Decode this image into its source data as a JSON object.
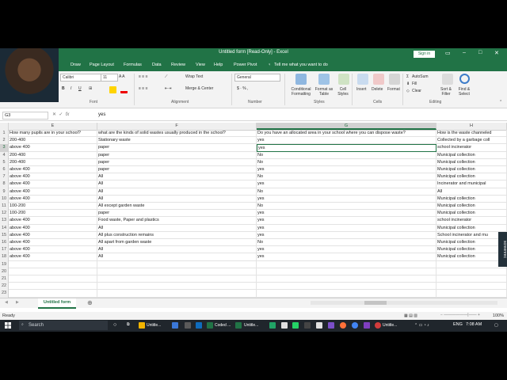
{
  "window": {
    "title": "Untitled form  [Read-Only]  -  Excel",
    "signin": "Sign in"
  },
  "tabs": [
    "et",
    "Draw",
    "Page Layout",
    "Formulas",
    "Data",
    "Review",
    "View",
    "Help",
    "Power Pivot",
    "Tell me what you want to do"
  ],
  "ribbon": {
    "font_name": "Calibri",
    "font_size": "11",
    "wrap_text": "Wrap Text",
    "merge_center": "Merge & Center",
    "number_format": "General",
    "number_symbols": "$ · % ,",
    "conditional_formatting": "Conditional Formatting",
    "format_as_table": "Format as Table",
    "cell_styles": "Cell Styles",
    "insert": "Insert",
    "delete": "Delete",
    "format": "Format",
    "autosum": "AutoSum",
    "fill": "Fill",
    "clear": "Clear",
    "sort_filter": "Sort & Filter",
    "find_select": "Find & Select",
    "groups": {
      "font": "Font",
      "alignment": "Alignment",
      "number": "Number",
      "styles": "Styles",
      "cells": "Cells",
      "editing": "Editing"
    }
  },
  "formula_bar": {
    "name_box": "G3",
    "value": "yes"
  },
  "columns": [
    "E",
    "F",
    "G",
    "H"
  ],
  "rows": [
    [
      "How many pupils are in your school?",
      "what are the kinds of solid wastes usually produced in the school?",
      "Do you have an allocated area in your school where you can dispose waste?",
      "How is the waste channeled"
    ],
    [
      "200-400",
      "Stationary waste",
      "yes",
      "Collected by a garbage coll"
    ],
    [
      "above 400",
      "paper",
      "yes",
      "school incinerator"
    ],
    [
      "200-400",
      "paper",
      "No",
      "Municipal collection"
    ],
    [
      "200-400",
      "paper",
      "No",
      "Municipal collection"
    ],
    [
      "above 400",
      "paper",
      "yes",
      "Municipal collection"
    ],
    [
      "above 400",
      "All",
      "No",
      "Municipal collection"
    ],
    [
      "above 400",
      "All",
      "yes",
      "Incinerator and municipal"
    ],
    [
      "above 400",
      "All",
      "No",
      "All"
    ],
    [
      "above 400",
      "All",
      "yes",
      "Municipal collection"
    ],
    [
      "100-200",
      "All except garden waste",
      "No",
      "Municipal collection"
    ],
    [
      "100-200",
      "paper",
      "yes",
      "Municipal collection"
    ],
    [
      "above 400",
      "Food waste, Paper and plastics",
      "yes",
      "school incinerator"
    ],
    [
      "above 400",
      "All",
      "yes",
      "Municipal collection"
    ],
    [
      "above 400",
      "All plus construction remains",
      "yes",
      "School incinerator and mu"
    ],
    [
      "above 400",
      "All apart from garden waste",
      "No",
      "Municipal collection"
    ],
    [
      "above 400",
      "All",
      "yes",
      "Municipal collection"
    ],
    [
      "above 400",
      "All",
      "yes",
      "Municipal collection"
    ],
    [
      "",
      "",
      "",
      ""
    ],
    [
      "",
      "",
      "",
      ""
    ],
    [
      "",
      "",
      "",
      ""
    ],
    [
      "",
      "",
      "",
      ""
    ],
    [
      "",
      "",
      "",
      ""
    ]
  ],
  "sheet_tab": "Untitled form",
  "status": {
    "ready": "Ready",
    "zoom": "100%"
  },
  "taskbar": {
    "search": "Search",
    "apps": [
      "Untitle...",
      "Coded ...",
      "Untitle...",
      "Untitle..."
    ],
    "lang": "ENG",
    "time": "7:08 AM"
  },
  "overlay": {
    "screenrec": "screenrec"
  },
  "colors": {
    "excel_green": "#217346",
    "ribbon_bg": "#f3f3f3",
    "taskbar_bg": "#20262c"
  }
}
